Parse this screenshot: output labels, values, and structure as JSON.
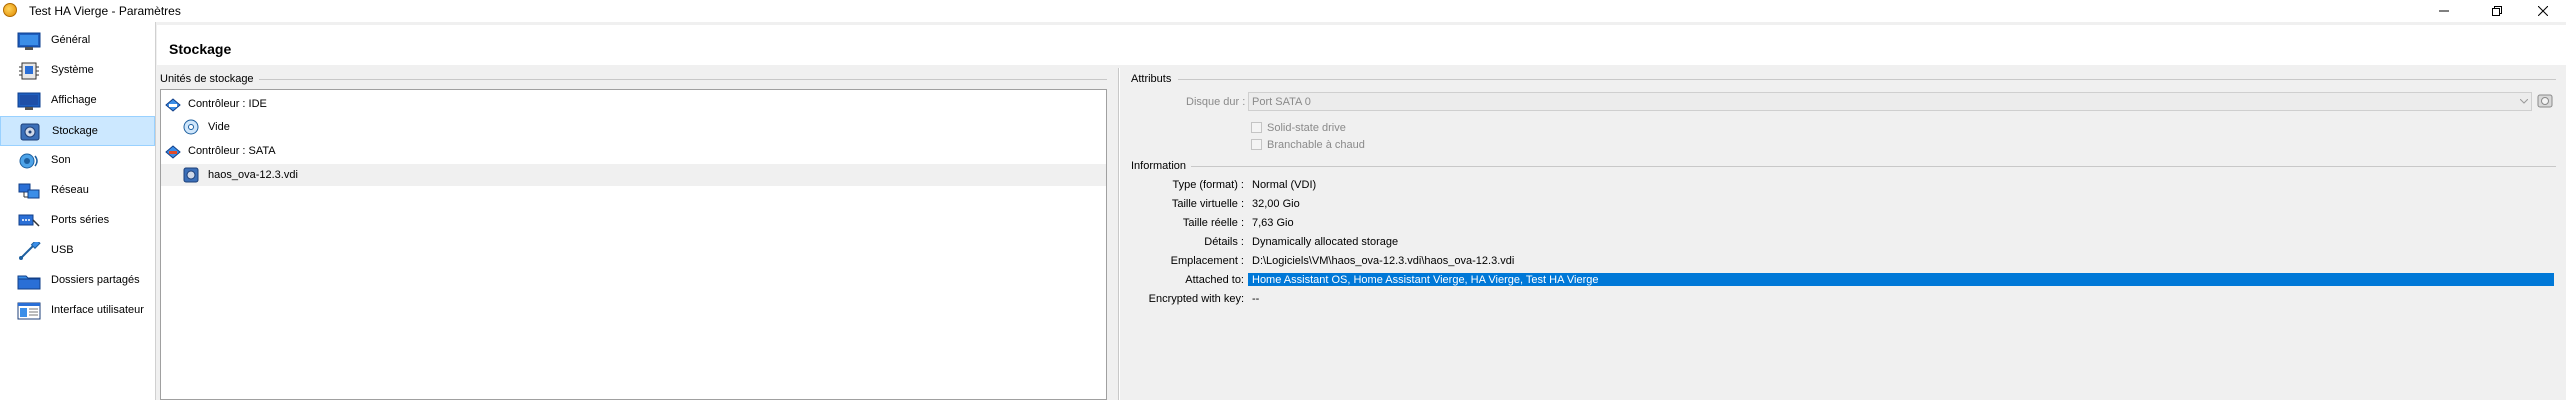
{
  "window": {
    "title": "Test HA Vierge - Paramètres",
    "icon": "virtualbox-icon",
    "controls": [
      "minimize-icon",
      "maximize-icon",
      "close-icon"
    ]
  },
  "sidebar": {
    "items": [
      {
        "label": "Général",
        "icon": "general-icon"
      },
      {
        "label": "Système",
        "icon": "system-icon"
      },
      {
        "label": "Affichage",
        "icon": "display-icon"
      },
      {
        "label": "Stockage",
        "icon": "storage-icon",
        "selected": true
      },
      {
        "label": "Son",
        "icon": "audio-icon"
      },
      {
        "label": "Réseau",
        "icon": "network-icon"
      },
      {
        "label": "Ports séries",
        "icon": "serial-ports-icon"
      },
      {
        "label": "USB",
        "icon": "usb-icon"
      },
      {
        "label": "Dossiers partagés",
        "icon": "shared-folders-icon"
      },
      {
        "label": "Interface utilisateur",
        "icon": "user-interface-icon"
      }
    ]
  },
  "page": {
    "title": "Stockage"
  },
  "storage": {
    "section_label": "Unités de stockage",
    "tree": [
      {
        "label": "Contrôleur : IDE",
        "icon": "ide-controller-icon",
        "level": 0
      },
      {
        "label": "Vide",
        "icon": "optical-disc-icon",
        "level": 1
      },
      {
        "label": "Contrôleur : SATA",
        "icon": "sata-controller-icon",
        "level": 0
      },
      {
        "label": "haos_ova-12.3.vdi",
        "icon": "hard-disk-icon",
        "level": 1,
        "selected": true
      }
    ]
  },
  "attributes": {
    "section_label": "Attributs",
    "hard_disk_label": "Disque dur :",
    "hard_disk_value": "Port SATA 0",
    "ssd_label": "Solid-state drive",
    "hotplug_label": "Branchable à chaud"
  },
  "information": {
    "section_label": "Information",
    "rows": [
      {
        "label": "Type (format) :",
        "value": "Normal (VDI)"
      },
      {
        "label": "Taille virtuelle :",
        "value": "32,00 Gio"
      },
      {
        "label": "Taille réelle :",
        "value": "7,63 Gio"
      },
      {
        "label": "Détails :",
        "value": "Dynamically allocated storage"
      },
      {
        "label": "Emplacement :",
        "value": "D:\\Logiciels\\VM\\haos_ova-12.3.vdi\\haos_ova-12.3.vdi"
      },
      {
        "label": "Attached to:",
        "value": "Home Assistant OS, Home Assistant Vierge, HA Vierge, Test HA Vierge",
        "highlighted": true
      },
      {
        "label": "Encrypted with key:",
        "value": "--"
      }
    ]
  },
  "colors": {
    "selection": "#cce8ff",
    "highlight": "#0078d7",
    "background": "#f0f0f0"
  }
}
